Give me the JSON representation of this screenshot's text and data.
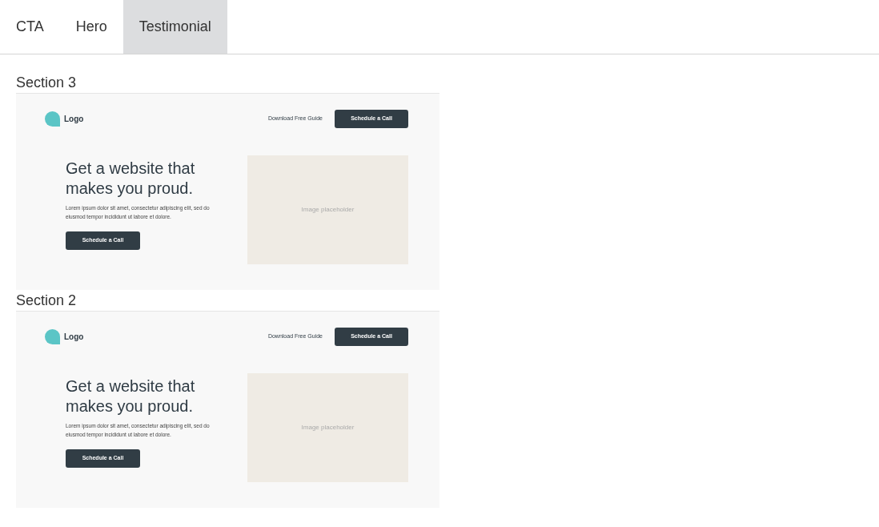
{
  "tabs": [
    {
      "label": "CTA",
      "selected": false
    },
    {
      "label": "Hero",
      "selected": false
    },
    {
      "label": "Testimonial",
      "selected": true
    }
  ],
  "sections": [
    {
      "title": "Section 3",
      "preview": {
        "logo": "Logo",
        "nav_link": "Download Free Guide",
        "nav_button": "Schedule a Call",
        "heading": "Get a website that makes you proud.",
        "body": "Lorem ipsum dolor sit amet, consectetur adipiscing elit, sed do eiusmod tempor incididunt ut labore et dolore.",
        "cta_button": "Schedule a Call",
        "image_placeholder": "Image placeholder"
      }
    },
    {
      "title": "Section 2",
      "preview": {
        "logo": "Logo",
        "nav_link": "Download Free Guide",
        "nav_button": "Schedule a Call",
        "heading": "Get a website that makes you proud.",
        "body": "Lorem ipsum dolor sit amet, consectetur adipiscing elit, sed do eiusmod tempor incididunt ut labore et dolore.",
        "cta_button": "Schedule a Call",
        "image_placeholder": "Image placeholder"
      }
    }
  ]
}
